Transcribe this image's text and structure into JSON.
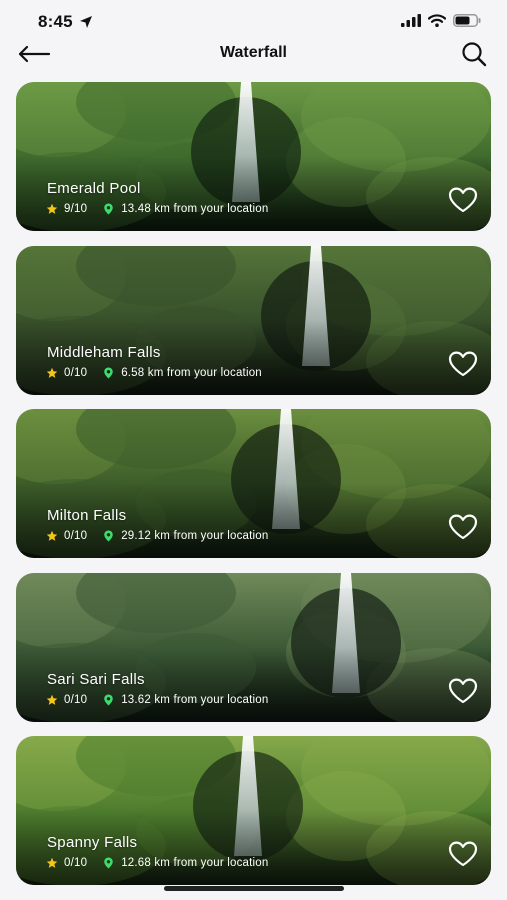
{
  "status_bar": {
    "time": "8:45"
  },
  "header": {
    "title": "Waterfall"
  },
  "colors": {
    "star": "#f5c518",
    "pin": "#3ddc6e",
    "text_on_image": "#ffffff"
  },
  "cards": [
    {
      "name": "Emerald Pool",
      "rating": "9/10",
      "distance": "13.48 km from your location",
      "palette": [
        "#1f3a1d",
        "#3f6b2e",
        "#6d9a45",
        "#0e1f10"
      ]
    },
    {
      "name": "Middleham Falls",
      "rating": "0/10",
      "distance": "6.58 km from your location",
      "palette": [
        "#1b2a1a",
        "#38512b",
        "#55753a",
        "#101810"
      ]
    },
    {
      "name": "Milton Falls",
      "rating": "0/10",
      "distance": "29.12 km from your location",
      "palette": [
        "#1c301b",
        "#3d5d29",
        "#6c8f3f",
        "#0f1b0f"
      ]
    },
    {
      "name": "Sari Sari Falls",
      "rating": "0/10",
      "distance": "13.62 km from your location",
      "palette": [
        "#1e2f22",
        "#3c5a36",
        "#718a5a",
        "#0f1a12"
      ]
    },
    {
      "name": "Spanny Falls",
      "rating": "0/10",
      "distance": "12.68 km from your location",
      "palette": [
        "#26401c",
        "#4f7d2e",
        "#86a94a",
        "#142212"
      ]
    }
  ]
}
